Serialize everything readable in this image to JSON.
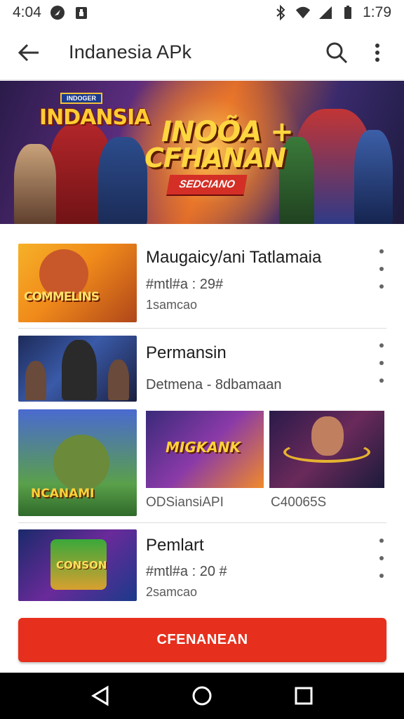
{
  "status_bar": {
    "time": "4:04",
    "battery_text": "1:79"
  },
  "app_bar": {
    "title": "Indanesia APk"
  },
  "banner": {
    "logo_tag": "INDOGER",
    "logo_word": "INDANSIA",
    "headline_1": "INOÕA +",
    "headline_2": "CFHANAN",
    "ribbon": "SEDCIANO"
  },
  "items": [
    {
      "title": "Maugaicy/ani Tatlamaia",
      "subtitle": "#mtl#a : 29#",
      "meta": "1samcao",
      "thumb_text": "COMMELINS"
    },
    {
      "title": "Permansin",
      "subtitle": "Detmena - 8dbamaan",
      "meta": ""
    },
    {
      "tiles": [
        {
          "caption": "",
          "thumb_text": "NCANAMI"
        },
        {
          "caption": "ODSiansiAPI",
          "thumb_text": "MIGKANK"
        },
        {
          "caption": "C40065S",
          "thumb_text": ""
        }
      ]
    },
    {
      "title": "Pemlart",
      "subtitle": "#mtl#a : 20 #",
      "meta": "2samcao",
      "thumb_text": "CONSON"
    }
  ],
  "cta": {
    "label": "CFENANEAN"
  },
  "icons": [
    "back-arrow-icon",
    "search-icon",
    "more-vert-icon",
    "nav-back-icon",
    "nav-home-icon",
    "nav-recents-icon"
  ]
}
